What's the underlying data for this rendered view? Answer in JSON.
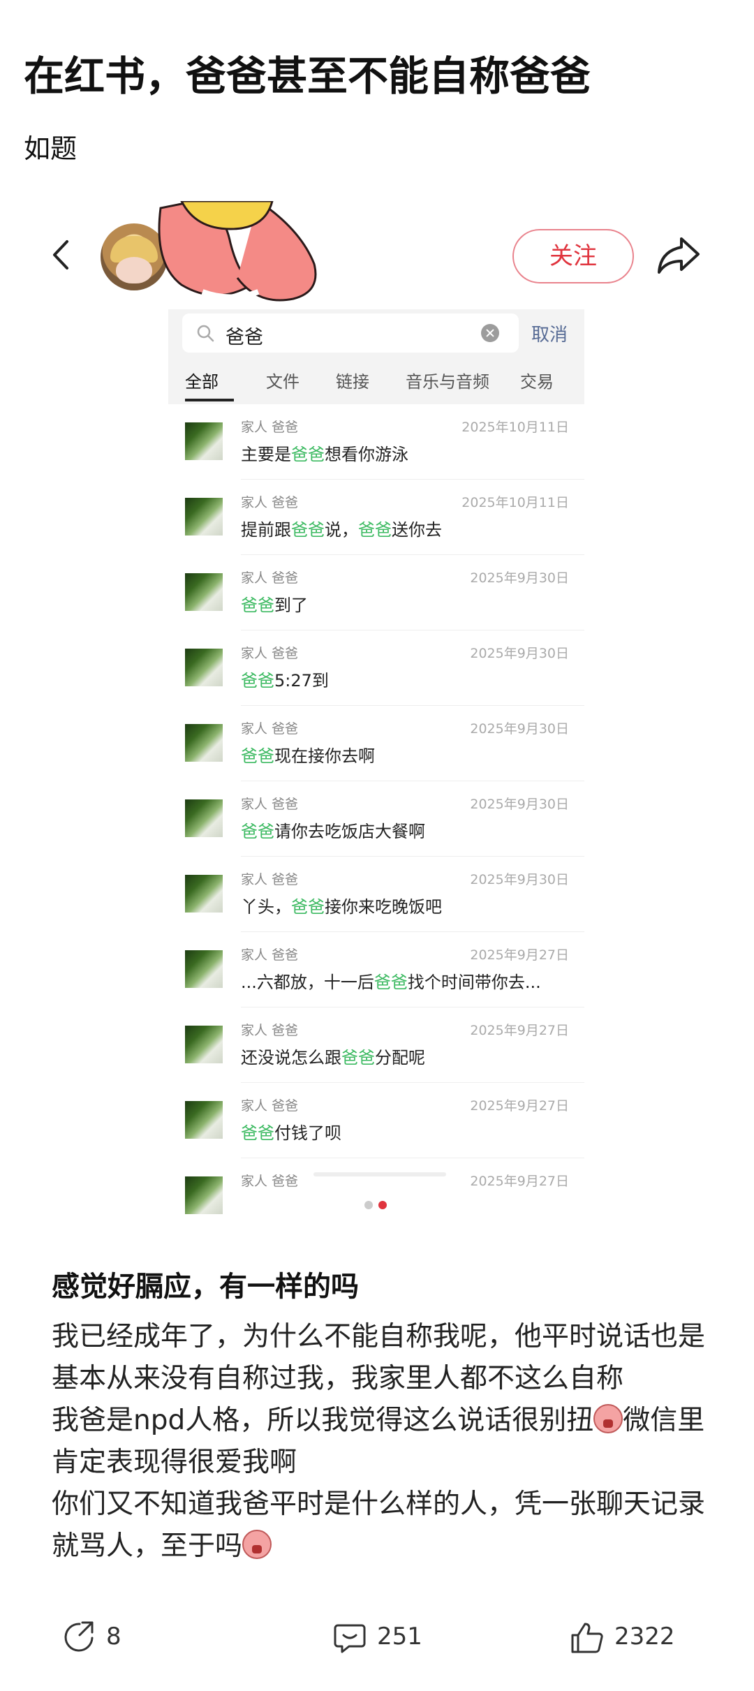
{
  "post": {
    "title": "在红书，爸爸甚至不能自称爸爸",
    "subtitle": "如题"
  },
  "embedded_header": {
    "follow_label": "关注",
    "accent_color": "#e0343e"
  },
  "wechat_search": {
    "query": "爸爸",
    "cancel_label": "取消",
    "tabs": [
      "全部",
      "文件",
      "链接",
      "音乐与音频",
      "交易"
    ],
    "active_tab": "全部",
    "highlight_color": "#3dba62",
    "results": [
      {
        "name": "家人 爸爸",
        "date": "2025年10月11日",
        "msg": [
          "主要是",
          "爸爸",
          "想看你游泳"
        ]
      },
      {
        "name": "家人 爸爸",
        "date": "2025年10月11日",
        "msg": [
          "提前跟",
          "爸爸",
          "说，",
          "爸爸",
          "送你去"
        ]
      },
      {
        "name": "家人 爸爸",
        "date": "2025年9月30日",
        "msg": [
          "",
          "爸爸",
          "到了"
        ]
      },
      {
        "name": "家人 爸爸",
        "date": "2025年9月30日",
        "msg": [
          "",
          "爸爸",
          "5:27到"
        ]
      },
      {
        "name": "家人 爸爸",
        "date": "2025年9月30日",
        "msg": [
          "",
          "爸爸",
          "现在接你去啊"
        ]
      },
      {
        "name": "家人 爸爸",
        "date": "2025年9月30日",
        "msg": [
          "",
          "爸爸",
          "请你去吃饭店大餐啊"
        ]
      },
      {
        "name": "家人 爸爸",
        "date": "2025年9月30日",
        "msg": [
          "丫头，",
          "爸爸",
          "接你来吃晚饭吧"
        ]
      },
      {
        "name": "家人 爸爸",
        "date": "2025年9月27日",
        "msg": [
          "...六都放，十一后",
          "爸爸",
          "找个时间带你去..."
        ]
      },
      {
        "name": "家人 爸爸",
        "date": "2025年9月27日",
        "msg": [
          "还没说怎么跟",
          "爸爸",
          "分配呢"
        ]
      },
      {
        "name": "家人 爸爸",
        "date": "2025年9月27日",
        "msg": [
          "",
          "爸爸",
          "付钱了呗"
        ]
      }
    ],
    "last_partial": {
      "name": "家人 爸爸",
      "date": "2025年9月27日"
    }
  },
  "pager": {
    "count": 2,
    "active": 2,
    "active_color": "#e0343e",
    "inactive_color": "#cccccc"
  },
  "post_body": {
    "heading": "感觉好膈应，有一样的吗",
    "p1": "我已经成年了，为什么不能自称我呢，他平时说话也是基本从来没有自称过我，我家里人都不这么自称",
    "p2a": "我爸是npd人格，所以我觉得这么说话很别扭",
    "p2b": "微信里肯定表现得很爱我啊",
    "p3a": "你们又不知道我爸平时是什么样的人，凭一张聊天记录就骂人，至于吗",
    "emoji_icon": "angry-face-icon"
  },
  "actions": {
    "share_count": "8",
    "comment_count": "251",
    "like_count": "2322"
  }
}
